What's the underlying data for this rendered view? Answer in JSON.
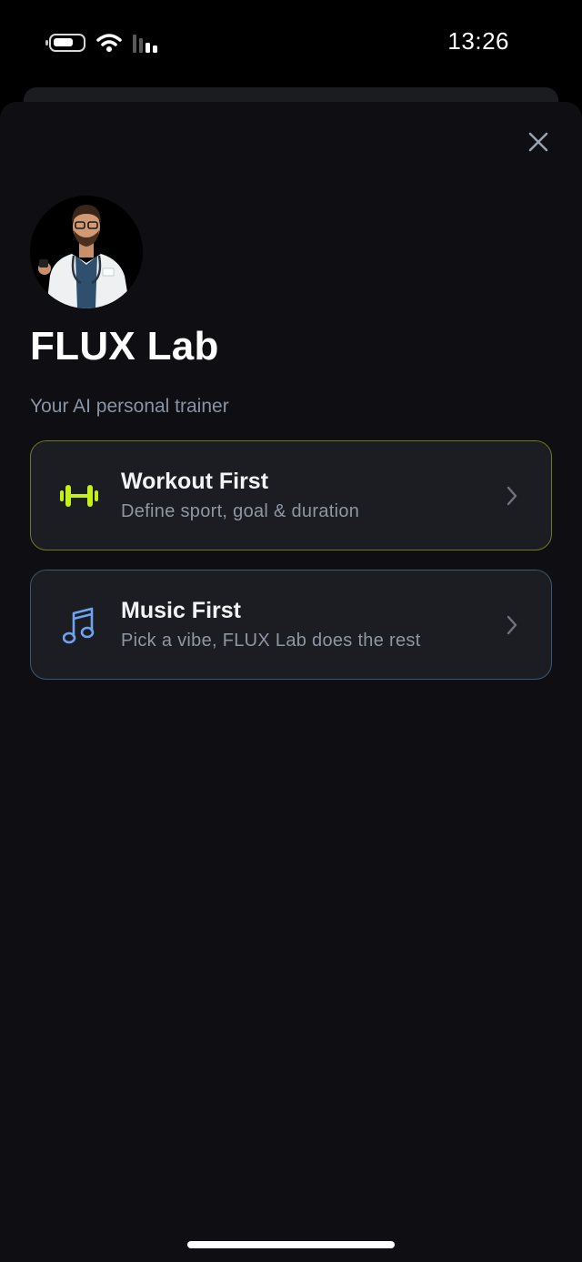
{
  "status_bar": {
    "time": "13:26",
    "icons": [
      "battery-icon",
      "wifi-icon",
      "signal-icon"
    ]
  },
  "modal": {
    "close_icon": "close-icon",
    "avatar": "trainer-avatar",
    "title": "FLUX Lab",
    "subtitle": "Your AI personal trainer",
    "options": [
      {
        "icon": "dumbbell-icon",
        "title": "Workout First",
        "description": "Define sport, goal & duration",
        "accent": "#c6f01a",
        "border": "#6f7a1e"
      },
      {
        "icon": "music-note-icon",
        "title": "Music First",
        "description": "Pick a vibe, FLUX Lab does the rest",
        "accent": "#6fa3f2",
        "border": "#3c5677"
      }
    ]
  },
  "colors": {
    "background": "#0f0f13",
    "card": "#1c1d22"
  }
}
